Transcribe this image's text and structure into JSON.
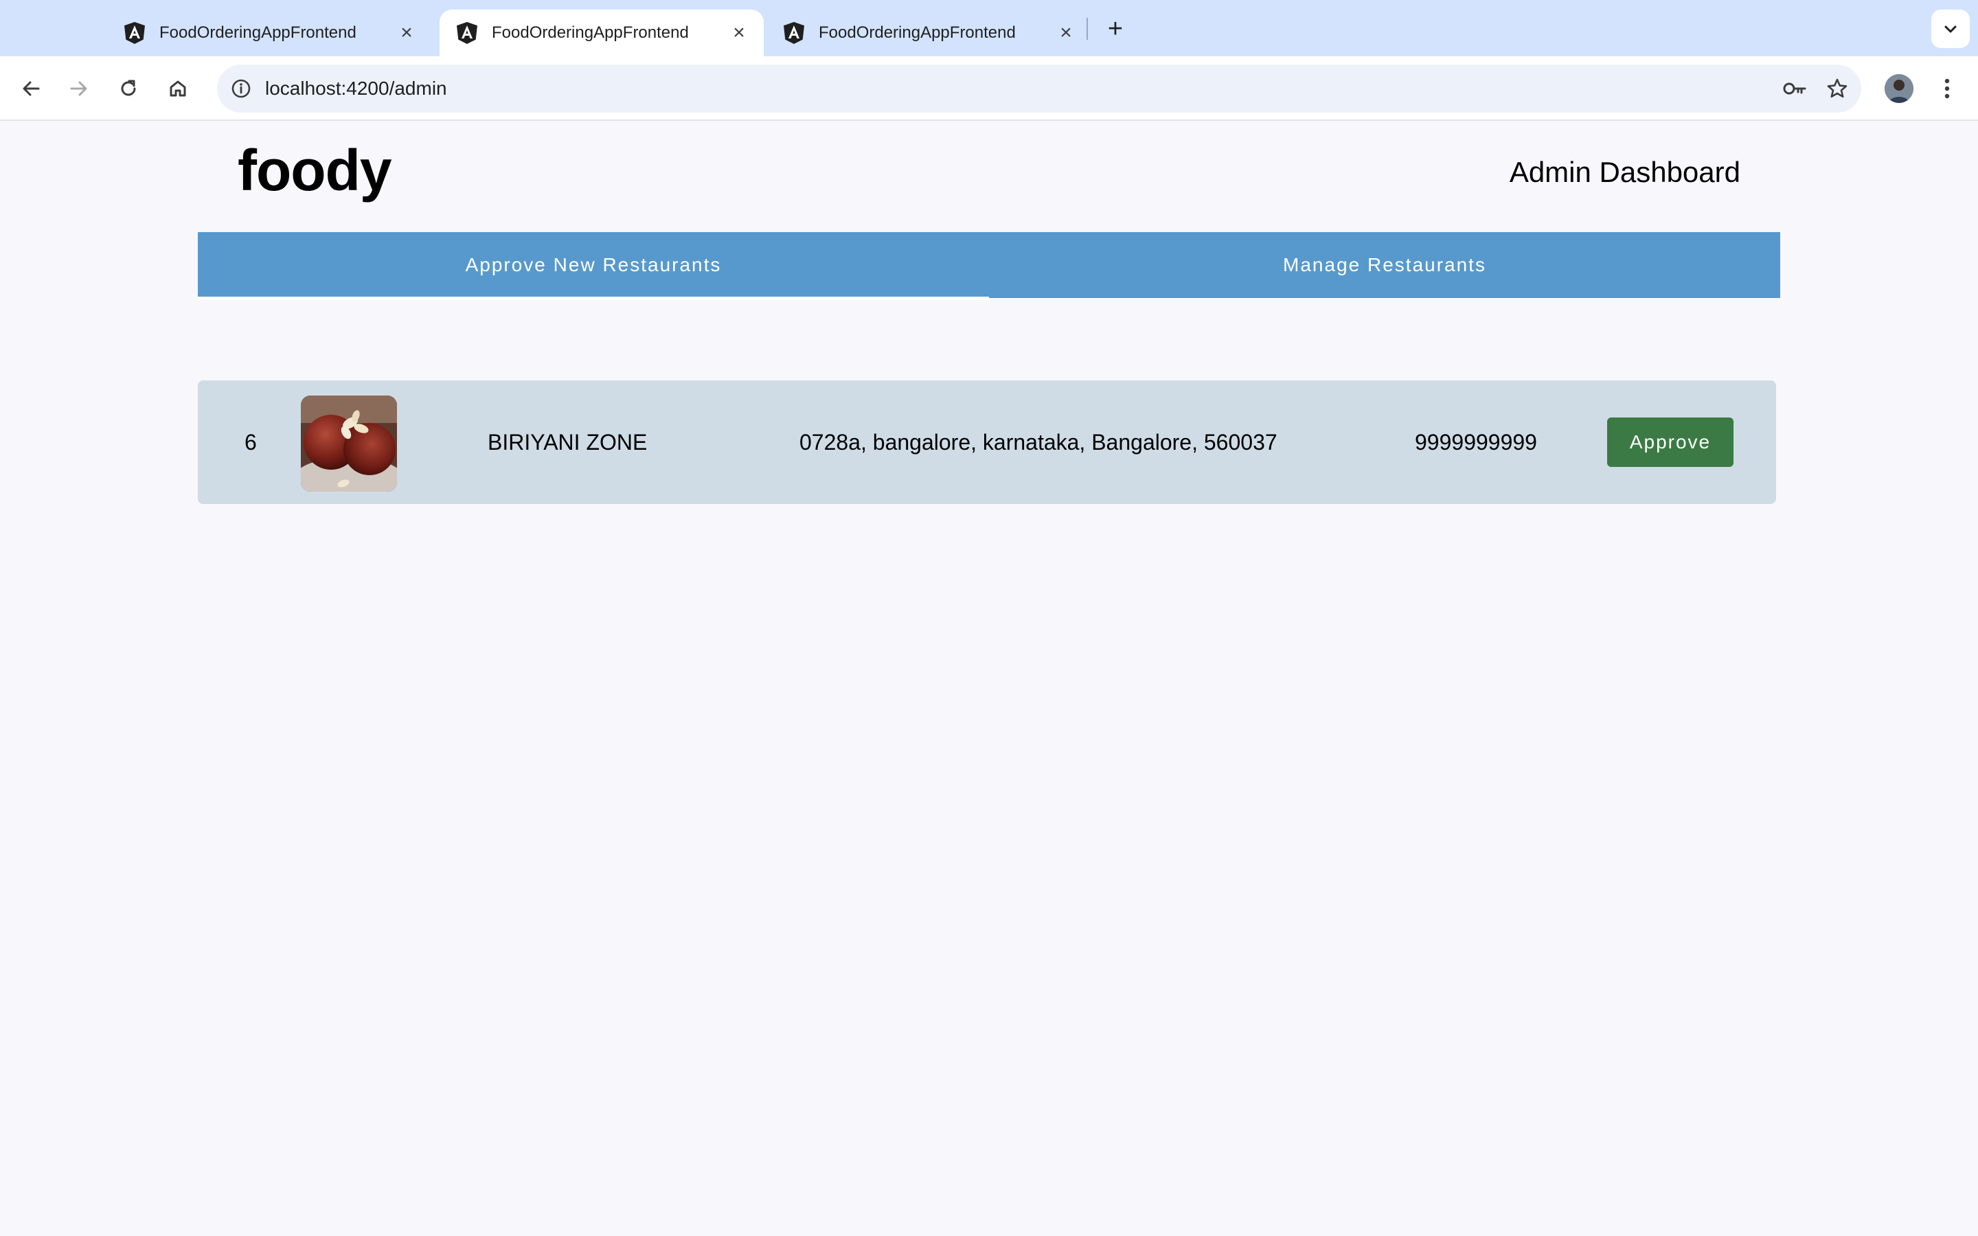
{
  "browser": {
    "tabs": [
      {
        "title": "FoodOrderingAppFrontend",
        "active": false
      },
      {
        "title": "FoodOrderingAppFrontend",
        "active": true
      },
      {
        "title": "FoodOrderingAppFrontend",
        "active": false
      }
    ],
    "favicon": "angular-logo-icon",
    "url": "localhost:4200/admin",
    "nav_icons": [
      "back-arrow-icon",
      "forward-arrow-icon",
      "reload-icon",
      "home-icon"
    ],
    "omnibox_icons": [
      "site-info-icon",
      "password-key-icon",
      "bookmark-star-icon"
    ],
    "accent_tabstrip": "#d3e3fd"
  },
  "app": {
    "brand": "foody",
    "heading": "Admin Dashboard",
    "tabs": [
      {
        "label": "Approve New Restaurants",
        "selected": true
      },
      {
        "label": "Manage Restaurants",
        "selected": false
      }
    ],
    "tabbar_color": "#5799cc",
    "pending_restaurants": [
      {
        "id": "6",
        "image": "gulab-jamun-food-photo",
        "name": "BIRIYANI ZONE",
        "address": "0728a, bangalore, karnataka, Bangalore, 560037",
        "phone": "9999999999",
        "action_label": "Approve"
      }
    ],
    "row_color": "#cfdce6",
    "approve_color": "#3b7a44"
  }
}
